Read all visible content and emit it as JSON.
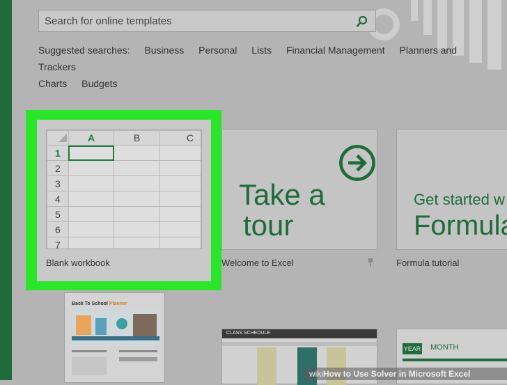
{
  "search": {
    "placeholder": "Search for online templates"
  },
  "suggested": {
    "label": "Suggested searches:",
    "items": [
      "Business",
      "Personal",
      "Lists",
      "Financial Management",
      "Planners and Trackers",
      "Charts",
      "Budgets"
    ]
  },
  "tiles": {
    "blank": {
      "label": "Blank workbook",
      "columns": [
        "A",
        "B",
        "C"
      ],
      "rows": [
        "1",
        "2",
        "3",
        "4",
        "5",
        "6",
        "7"
      ]
    },
    "tour": {
      "line1": "Take a",
      "line2": "tour",
      "label": "Welcome to Excel"
    },
    "formula": {
      "line1": "Get started w",
      "line2": "Formula",
      "label": "Formula tutorial"
    },
    "school": {
      "title_a": "Back To School ",
      "title_b": "Planner"
    },
    "schedule": {
      "title": "CLASS SCHEDULE"
    },
    "month": {
      "year": "YEAR",
      "month": "MONTH"
    }
  },
  "watermark": {
    "brand": "wiki",
    "text": "How to Use Solver in Microsoft Excel"
  },
  "colors": {
    "excel_green": "#1f6b3a",
    "highlight": "#2be52b"
  }
}
